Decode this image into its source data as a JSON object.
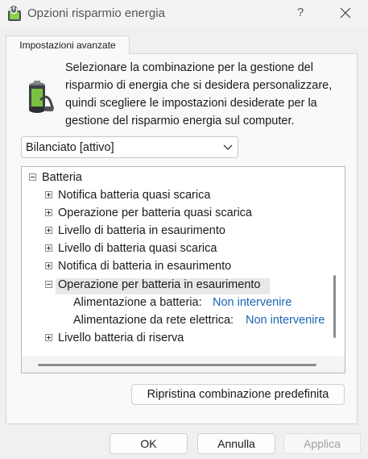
{
  "window": {
    "title": "Opzioni risparmio energia",
    "help_label": "?",
    "icons": {
      "app": "power-options-icon",
      "close": "close-icon"
    }
  },
  "tab": {
    "label": "Impostazioni avanzate"
  },
  "description": "Selezionare la combinazione per la gestione del risparmio di energia che si desidera personalizzare, quindi scegliere le impostazioni desiderate per la gestione del risparmio energia sul computer.",
  "plan_select": {
    "value": "Bilanciato [attivo]"
  },
  "tree": {
    "root": "Batteria",
    "items": [
      "Notifica batteria quasi scarica",
      "Operazione per batteria quasi scarica",
      "Livello di batteria in esaurimento",
      "Livello di batteria quasi scarica",
      "Notifica di batteria in esaurimento",
      "Operazione per batteria in esaurimento",
      "Livello batteria di riserva"
    ],
    "settings": [
      {
        "label": "Alimentazione a batteria:",
        "value": "Non intervenire"
      },
      {
        "label": "Alimentazione da rete elettrica:",
        "value": "Non intervenire"
      }
    ]
  },
  "buttons": {
    "restore": "Ripristina combinazione predefinita",
    "ok": "OK",
    "cancel": "Annulla",
    "apply": "Applica"
  },
  "colors": {
    "accent_link": "#1a64b4",
    "window_bg": "#f0f0f0"
  }
}
